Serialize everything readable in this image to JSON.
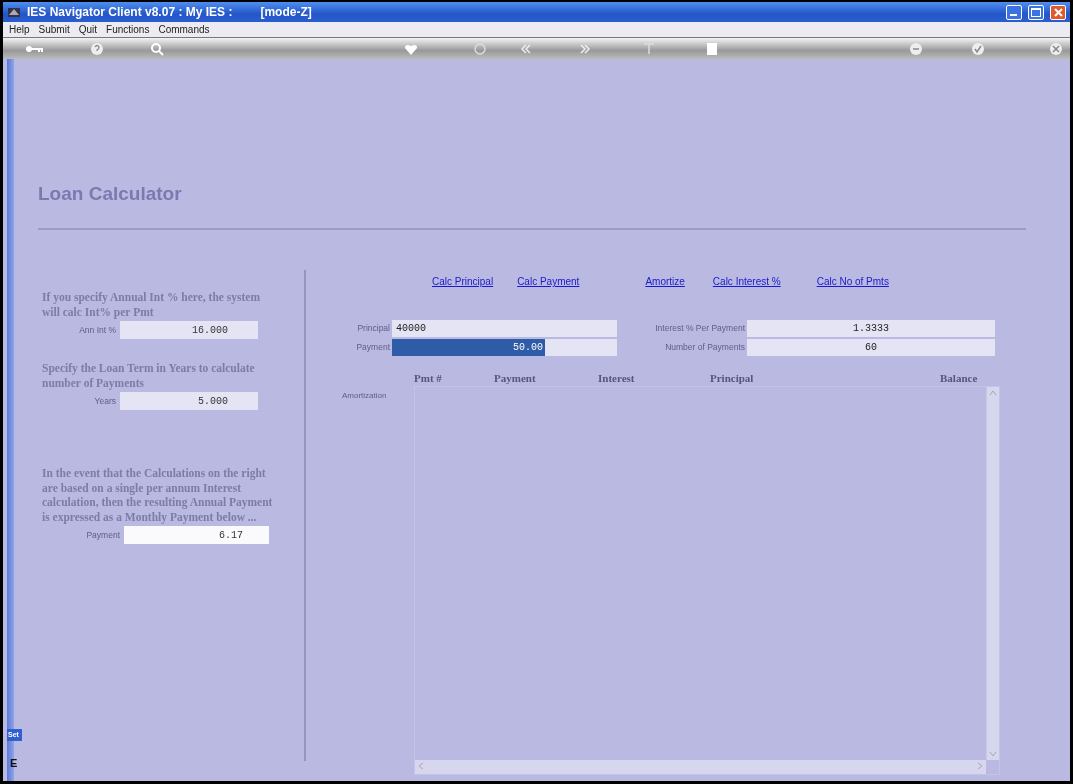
{
  "window": {
    "title": "IES Navigator Client v8.07 : My IES :",
    "mode": "[mode-Z]"
  },
  "menu": [
    "Help",
    "Submit",
    "Quit",
    "Functions",
    "Commands"
  ],
  "page_title": "Loan Calculator",
  "left_panel": [
    {
      "text": "If you specify Annual Int % here, the system will calc Int% per Pmt",
      "label": "Ann Int %",
      "value": "16.000"
    },
    {
      "text": "Specify the Loan Term in Years to calculate number of Payments",
      "label": "Years",
      "value": "5.000"
    },
    {
      "text": "In the event that the Calculations on the right are based on a single per annum Interest calculation, then the resulting Annual Payment is expressed as a Monthly Payment below ...",
      "label": "Payment",
      "value": "6.17"
    }
  ],
  "actions": [
    "Calc Principal",
    "Calc Payment",
    "Amortize",
    "Calc Interest %",
    "Calc No of Pmts"
  ],
  "fields_left": [
    {
      "label": "Principal",
      "value": "40000",
      "selected": false
    },
    {
      "label": "Payment",
      "value": "50.00",
      "selected": true
    }
  ],
  "fields_right": [
    {
      "label": "Interest % Per Payment",
      "value": "1.3333"
    },
    {
      "label": "Number of Payments",
      "value": "60"
    }
  ],
  "amortization": {
    "label": "Amortization",
    "columns": [
      "Pmt #",
      "Payment",
      "Interest",
      "Principal",
      "Balance"
    ]
  },
  "side_tab": "Set",
  "side_letter": "E"
}
